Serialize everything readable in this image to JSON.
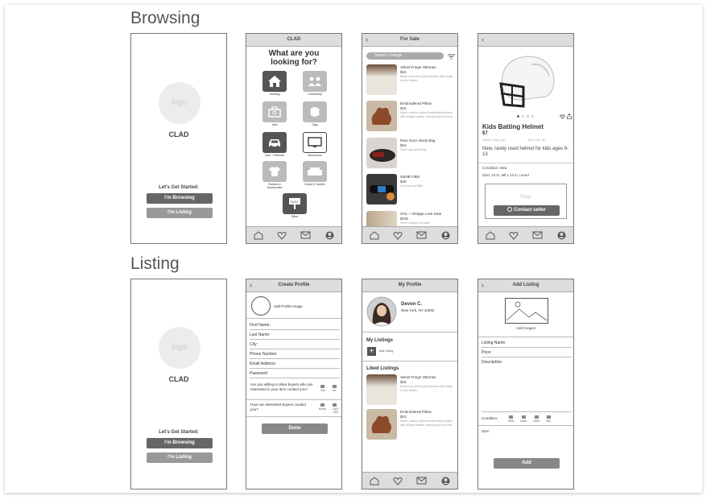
{
  "sections": {
    "browsing": "Browsing",
    "listing": "Listing"
  },
  "splash": {
    "logo": "logo",
    "brand": "CLAD",
    "start": "Let's Get Started:",
    "browse_btn": "I'm Browsing",
    "list_btn": "I'm Listing"
  },
  "categories_screen": {
    "header": "CLAD",
    "question_line1": "What are you",
    "question_line2": "looking for?",
    "items": [
      {
        "label": "Housing",
        "icon": "home-icon"
      },
      {
        "label": "Community",
        "icon": "people-icon"
      },
      {
        "label": "Jobs",
        "icon": "briefcase-icon"
      },
      {
        "label": "Gigs",
        "icon": "brain-icon"
      },
      {
        "label": "Cars + Vehicles",
        "icon": "car-icon"
      },
      {
        "label": "Electronics",
        "icon": "monitor-icon"
      },
      {
        "label": "Fashion & Accessories",
        "icon": "shirt-icon"
      },
      {
        "label": "Home & Garden",
        "icon": "sofa-icon"
      },
      {
        "label": "Other",
        "icon": "sign-icon"
      }
    ],
    "other_sign": "MISC"
  },
  "for_sale_screen": {
    "header": "For Sale",
    "search_placeholder": "Search Listings",
    "listings": [
      {
        "title": "Velvet Fringe Ottoman",
        "price": "$15",
        "desc": "Brand new velvet gold ottoman with fringe on the bottom"
      },
      {
        "title": "Embroidered Pillow",
        "price": "$10",
        "desc": "Small, custom colored embroidered pillow with antique details, bearing dark seconds"
      },
      {
        "title": "Rare Gucci Body Bag",
        "price": "$10",
        "desc": "Some rare gucci bag"
      },
      {
        "title": "GENE Fitbit",
        "price": "$40",
        "desc": "Good as new fitbit"
      },
      {
        "title": "Chic + Vintage Love Seat",
        "price": "$100",
        "desc": "Some vintage love seat"
      }
    ]
  },
  "item_screen": {
    "title": "Kids Batting Helmet",
    "price": "$7",
    "posted": "posted 4 days ago",
    "location": "New York, NY",
    "desc": "New, rarely used helmet for kids ages 9-13",
    "condition": "Condition: New",
    "size": "Size: 15 in. tall x 12 in. round",
    "map": "Map",
    "contact_btn": "Contact seller"
  },
  "create_profile_screen": {
    "header": "Create Profile",
    "add_image": "Add Profile Image",
    "fields": [
      "First Name:",
      "Last Name:",
      "City:",
      "Phone Number",
      "Email Address",
      "Password"
    ],
    "q1": "Are you willing to allow buyers who are interested in your item contact you?",
    "q1_opts": [
      "Yes",
      "No"
    ],
    "q2": "How can interested buyers contact you?",
    "q2_opts": [
      "Email",
      "Call / Text"
    ],
    "done_btn": "Done"
  },
  "my_profile_screen": {
    "header": "My Profile",
    "name": "Devon C.",
    "location": "New York, NY 10002",
    "my_listings": "My Listings",
    "add_listing": "Add Listing",
    "liked_listings": "Liked Listings",
    "liked": [
      {
        "title": "Velvet Fringe Ottoman",
        "price": "$15",
        "desc": "Brand new velvet gold ottoman with fringe on the bottom"
      },
      {
        "title": "Embroidered Pillow",
        "price": "$10",
        "desc": "Small, custom colored embroidered pillow with antique details, bearing and seconds"
      }
    ]
  },
  "add_listing_screen": {
    "header": "Add Listing",
    "add_images": "Add Images",
    "fields": [
      "Listing Name:",
      "Price:",
      "Description:"
    ],
    "condition": "Condition:",
    "condition_opts": [
      "New",
      "Used",
      "Used",
      "Old"
    ],
    "size": "Size:",
    "add_btn": "Add"
  },
  "colors": {
    "dark_btn": "#666666",
    "light_btn": "#999999",
    "header_bg": "#dddddd"
  }
}
